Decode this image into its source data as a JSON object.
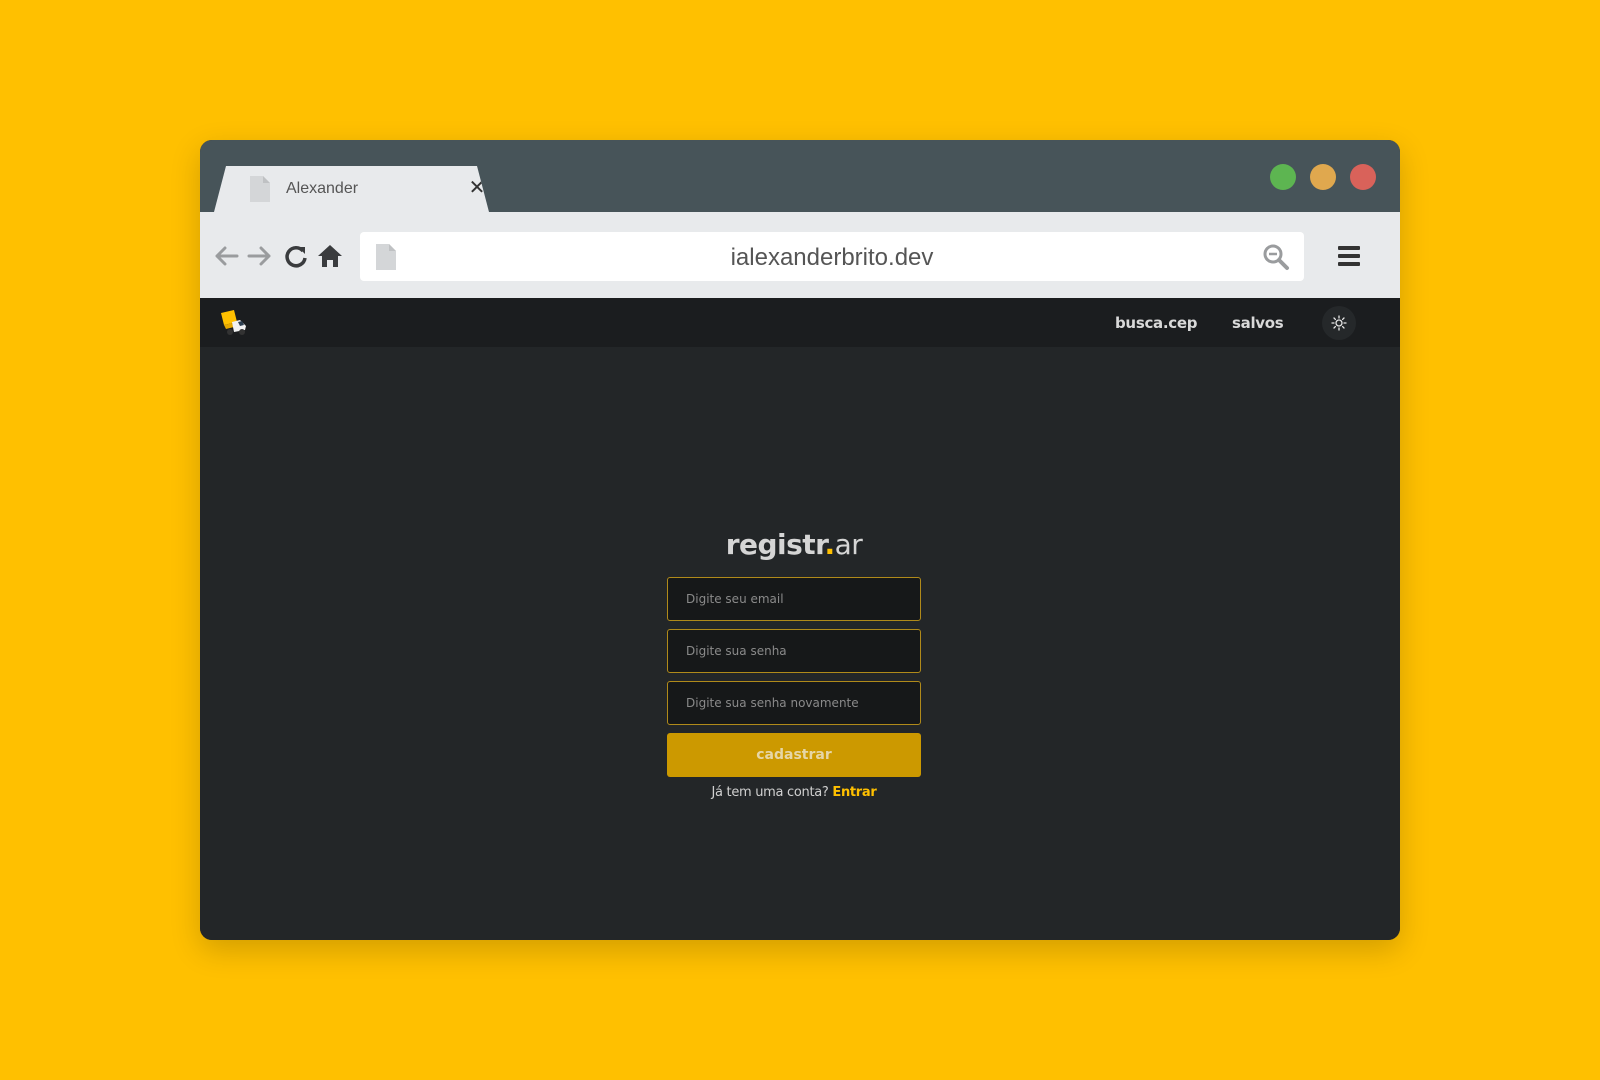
{
  "browser": {
    "tab_title": "Alexander",
    "tab_close": "✕",
    "url": "ialexanderbrito.dev"
  },
  "window_controls": {
    "green": "#5DB551",
    "yellow": "#E0A84E",
    "red": "#D9625A"
  },
  "site": {
    "nav": {
      "busca_label": "busca.cep",
      "salvos_label": "salvos"
    },
    "theme_icon": "sun-icon"
  },
  "form": {
    "title_bold": "registr",
    "title_dot": ".",
    "title_light": "ar",
    "email_placeholder": "Digite seu email",
    "password_placeholder": "Digite sua senha",
    "password_confirm_placeholder": "Digite sua senha novamente",
    "submit_label": "cadastrar",
    "login_prompt": "Já tem uma conta? ",
    "login_link": "Entrar"
  },
  "colors": {
    "page_background": "#FFC000",
    "accent": "#FFC000",
    "button": "#CC9900",
    "app_background": "#232628"
  }
}
